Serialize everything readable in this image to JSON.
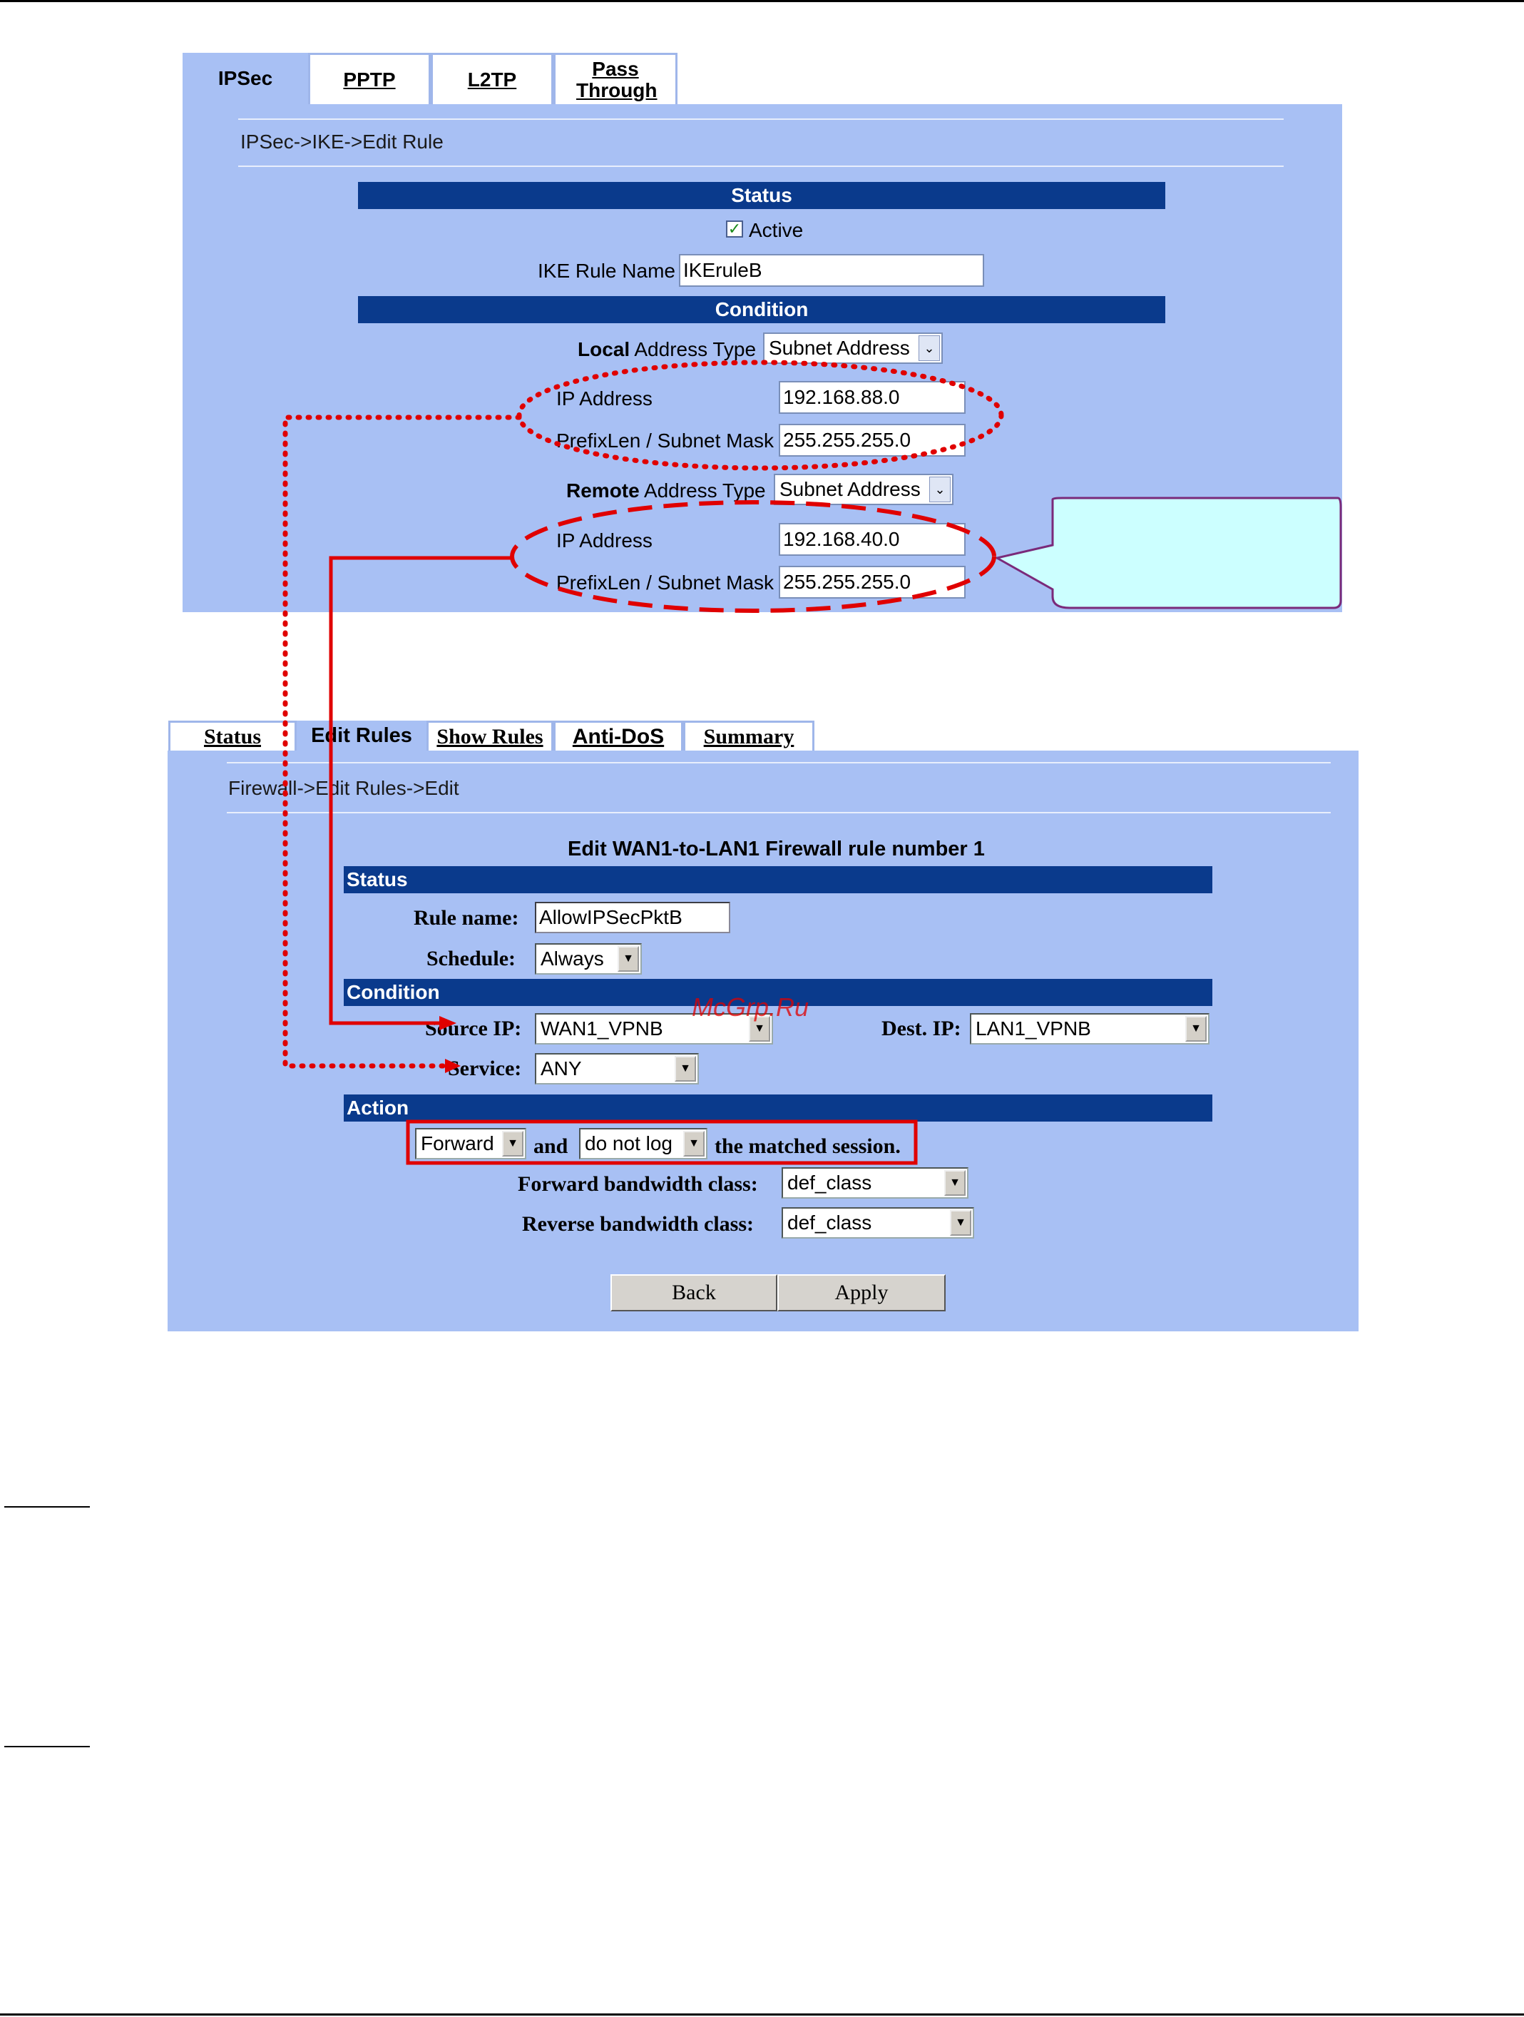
{
  "ipsec_panel": {
    "tabs": [
      {
        "label": "IPSec"
      },
      {
        "label": "PPTP"
      },
      {
        "label": "L2TP"
      },
      {
        "label": "Pass Through"
      }
    ],
    "breadcrumb": "IPSec->IKE->Edit Rule",
    "status_header": "Status",
    "active_label": "Active",
    "active_checked": true,
    "ike_rule_name_label": "IKE Rule Name",
    "ike_rule_name_value": "IKEruleB",
    "condition_header": "Condition",
    "local": {
      "type_label_bold": "Local",
      "type_label_rest": " Address Type",
      "type_value": "Subnet Address",
      "ip_label": "IP Address",
      "ip_value": "192.168.88.0",
      "mask_label": "PrefixLen / Subnet Mask",
      "mask_value": "255.255.255.0"
    },
    "remote": {
      "type_label_bold": "Remote",
      "type_label_rest": " Address Type",
      "type_value": "Subnet Address",
      "ip_label": "IP Address",
      "ip_value": "192.168.40.0",
      "mask_label": "PrefixLen / Subnet Mask",
      "mask_value": "255.255.255.0"
    }
  },
  "firewall_panel": {
    "tabs": [
      {
        "label": "Status"
      },
      {
        "label": "Edit Rules"
      },
      {
        "label": "Show Rules"
      },
      {
        "label": "Anti-DoS"
      },
      {
        "label": "Summary"
      }
    ],
    "breadcrumb": "Firewall->Edit Rules->Edit",
    "title": "Edit WAN1-to-LAN1 Firewall rule number 1",
    "status_header": "Status",
    "rule_name_label": "Rule name:",
    "rule_name_value": "AllowIPSecPktB",
    "schedule_label": "Schedule:",
    "schedule_value": "Always",
    "condition_header": "Condition",
    "source_ip_label": "Source IP:",
    "source_ip_value": "WAN1_VPNB",
    "dest_ip_label": "Dest. IP:",
    "dest_ip_value": "LAN1_VPNB",
    "service_label": "Service:",
    "service_value": "ANY",
    "action_header": "Action",
    "action_value": "Forward",
    "and_text": "and",
    "log_value": "do not log",
    "matched_text": "the matched session.",
    "fwd_bw_label": "Forward bandwidth class:",
    "fwd_bw_value": "def_class",
    "rev_bw_label": "Reverse bandwidth class:",
    "rev_bw_value": "def_class",
    "back_label": "Back",
    "apply_label": "Apply"
  },
  "watermark": "McGrp.Ru",
  "colors": {
    "panel_bg": "#a8c0f4",
    "header_bar": "#0a3a8c",
    "annotation_red": "#e00000",
    "callout_fill": "#ccffff",
    "callout_border": "#7a2a7a"
  }
}
